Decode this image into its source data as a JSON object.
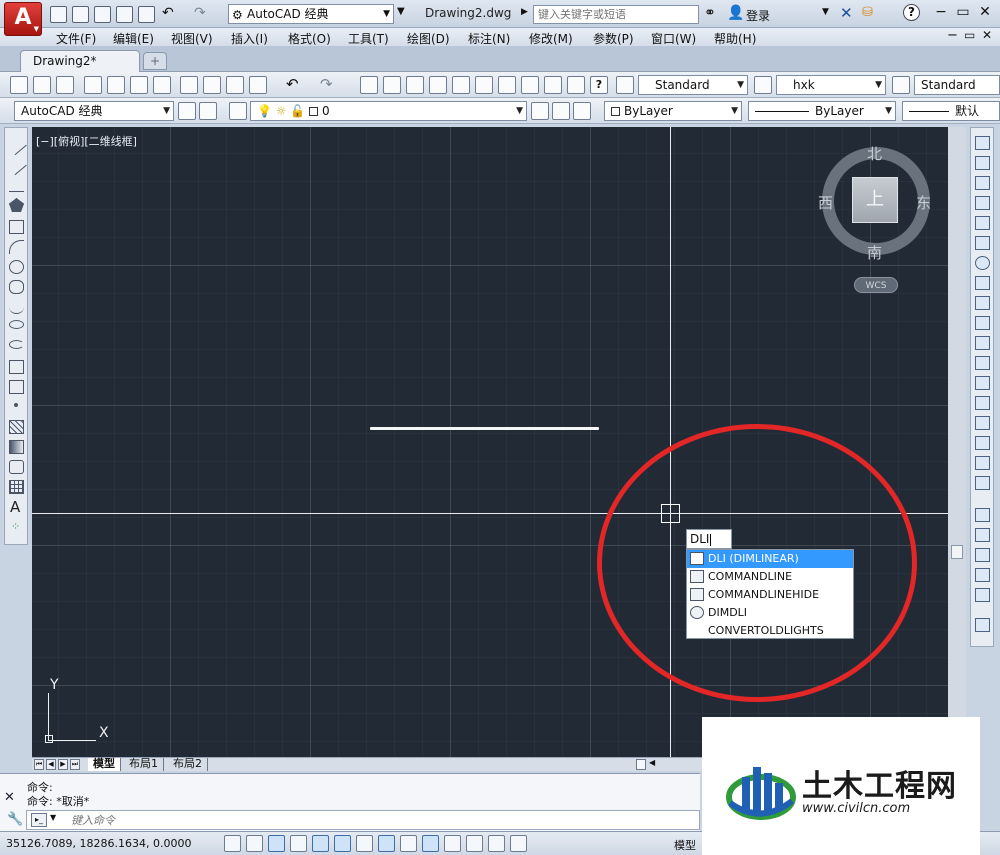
{
  "app": {
    "logo_letter": "A",
    "workspace": "AutoCAD 经典",
    "document_title": "Drawing2.dwg",
    "search_placeholder": "键入关键字或短语",
    "login_label": "登录"
  },
  "menu": {
    "items": [
      "文件(F)",
      "编辑(E)",
      "视图(V)",
      "插入(I)",
      "格式(O)",
      "工具(T)",
      "绘图(D)",
      "标注(N)",
      "修改(M)",
      "参数(P)",
      "窗口(W)",
      "帮助(H)"
    ]
  },
  "tabs": {
    "active": "Drawing2*"
  },
  "toolbar1": {
    "text_style": "Standard",
    "dim_style": "hxk",
    "table_style": "Standard"
  },
  "toolbar2": {
    "workspace": "AutoCAD 经典",
    "layer": "0",
    "color": "ByLayer",
    "linetype": "ByLayer",
    "lineweight": "默认"
  },
  "viewport": {
    "label": "[−][俯视][二维线框]"
  },
  "viewcube": {
    "top_face": "上",
    "north": "北",
    "south": "南",
    "east": "东",
    "west": "西",
    "ucs_button": "WCS"
  },
  "ucs_icon": {
    "x_label": "X",
    "y_label": "Y"
  },
  "dynamic_input": {
    "value": "DLI"
  },
  "autocomplete": {
    "items": [
      {
        "label": "DLI (DIMLINEAR)",
        "icon": "dimlinear-icon",
        "selected": true
      },
      {
        "label": "COMMANDLINE",
        "icon": "commandline-icon",
        "selected": false
      },
      {
        "label": "COMMANDLINEHIDE",
        "icon": "commandlinehide-icon",
        "selected": false
      },
      {
        "label": "DIMDLI",
        "icon": "gear-icon",
        "selected": false
      },
      {
        "label": "CONVERTOLDLIGHTS",
        "icon": "",
        "selected": false
      }
    ]
  },
  "layout_tabs": {
    "model": "模型",
    "layout1": "布局1",
    "layout2": "布局2"
  },
  "command": {
    "history": [
      "命令:",
      "命令: *取消*"
    ],
    "input_placeholder": "键入命令"
  },
  "status": {
    "coordinates": "35126.7089, 18286.1634, 0.0000",
    "model_label": "模型"
  },
  "watermark": {
    "title": "土木工程网",
    "url": "www.civilcn.com"
  },
  "colors": {
    "viewport_bg": "#222a35",
    "annotation_red": "#e32626",
    "selection_blue": "#3399ff",
    "logo_red": "#c8201b"
  }
}
